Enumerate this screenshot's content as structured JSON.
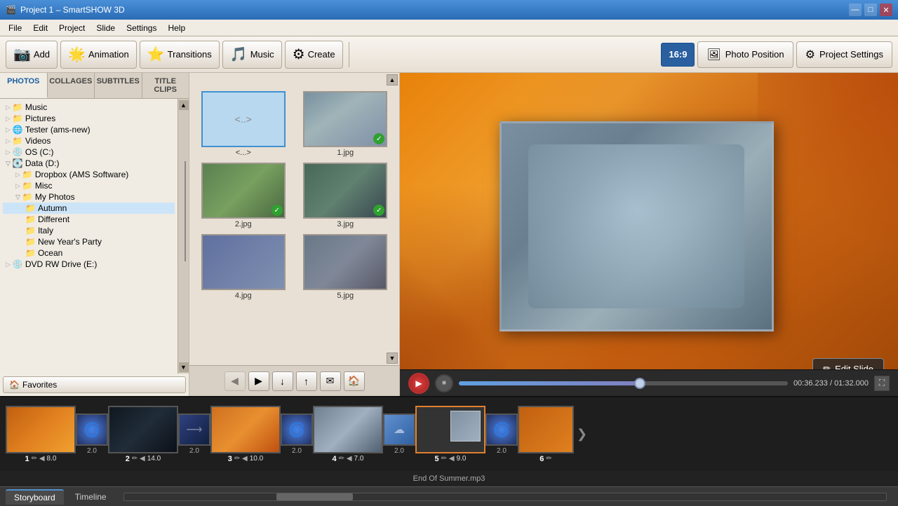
{
  "app": {
    "title": "Project 1 – SmartSHOW 3D",
    "icon": "🎬"
  },
  "titlebar": {
    "title": "Project 1 – SmartSHOW 3D",
    "minimize": "—",
    "maximize": "□",
    "close": "✕"
  },
  "menubar": {
    "items": [
      "File",
      "Edit",
      "Project",
      "Slide",
      "Settings",
      "Help"
    ]
  },
  "toolbar": {
    "add_label": "Add",
    "animation_label": "Animation",
    "transitions_label": "Transitions",
    "music_label": "Music",
    "create_label": "Create",
    "ratio_label": "16:9",
    "photo_position_label": "Photo Position",
    "project_settings_label": "Project Settings"
  },
  "left_panel": {
    "tabs": [
      "PHOTOS",
      "COLLAGES",
      "SUBTITLES",
      "TITLE CLIPS"
    ],
    "active_tab": "PHOTOS",
    "tree": [
      {
        "label": "Music",
        "icon": "folder",
        "indent": 1
      },
      {
        "label": "Pictures",
        "icon": "folder",
        "indent": 1
      },
      {
        "label": "Tester (ams-new)",
        "icon": "network",
        "indent": 1
      },
      {
        "label": "Videos",
        "icon": "folder",
        "indent": 1
      },
      {
        "label": "OS (C:)",
        "icon": "drive",
        "indent": 1
      },
      {
        "label": "Data (D:)",
        "icon": "drive",
        "indent": 0,
        "expanded": true
      },
      {
        "label": "Dropbox (AMS Software)",
        "icon": "folder",
        "indent": 2
      },
      {
        "label": "Misc",
        "icon": "folder",
        "indent": 2
      },
      {
        "label": "My Photos",
        "icon": "folder",
        "indent": 2,
        "expanded": true
      },
      {
        "label": "Autumn",
        "icon": "folder_plain",
        "indent": 3,
        "selected": true
      },
      {
        "label": "Different",
        "icon": "folder_plain",
        "indent": 3
      },
      {
        "label": "Italy",
        "icon": "folder_plain",
        "indent": 3
      },
      {
        "label": "New Year's Party",
        "icon": "folder_plain",
        "indent": 3
      },
      {
        "label": "Ocean",
        "icon": "folder_plain",
        "indent": 3
      },
      {
        "label": "DVD RW Drive (E:)",
        "icon": "drive",
        "indent": 1
      }
    ],
    "favorites_label": "Favorites"
  },
  "photo_grid": {
    "scroll_up": "▲",
    "scroll_down": "▼",
    "photos": [
      {
        "label": "<...>",
        "type": "folder",
        "selected": true
      },
      {
        "label": "1.jpg",
        "type": "family_autumn",
        "checked": true
      },
      {
        "label": "2.jpg",
        "type": "autumn_kids",
        "checked": true
      },
      {
        "label": "3.jpg",
        "type": "family_outdoor",
        "checked": true
      },
      {
        "label": "4.jpg",
        "type": "family2",
        "checked": false
      },
      {
        "label": "5.jpg",
        "type": "family3",
        "checked": false
      }
    ],
    "actions": {
      "prev": "◀",
      "next": "▶",
      "down_arrow": "↓",
      "up_arrow": "↑",
      "envelope": "✉",
      "house": "🏠"
    }
  },
  "preview": {
    "edit_slide_label": "Edit Slide"
  },
  "playback": {
    "play_icon": "▶",
    "stop_icon": "■",
    "current_time": "00:36.233",
    "total_time": "01:32.000",
    "time_separator": " / ",
    "fullscreen_icon": "⛶",
    "progress_percent": 55
  },
  "storyboard": {
    "slides": [
      {
        "num": "1",
        "type": "autumn",
        "duration": "8.0",
        "icons": "✏ ◀"
      },
      {
        "num": "2",
        "type": "dark_landscape",
        "duration": "14.0",
        "icons": "✏ ◀"
      },
      {
        "num": "3",
        "type": "autumn_kids",
        "duration": "10.0",
        "icons": "✏ ◀"
      },
      {
        "num": "4",
        "type": "family",
        "duration": "7.0",
        "icons": "✏ ◀"
      },
      {
        "num": "5",
        "type": "family_group",
        "duration": "9.0",
        "icons": "✏ ◀",
        "selected": true
      },
      {
        "num": "6",
        "type": "partial",
        "duration": "",
        "icons": "✏"
      }
    ],
    "transitions": [
      {
        "type": "swirl"
      },
      {
        "type": "slide"
      },
      {
        "type": "swirl2"
      },
      {
        "type": "cloud"
      },
      {
        "type": "swirl3"
      },
      {
        "type": "cloud2"
      }
    ],
    "transition_duration": "2.0",
    "music_label": "End Of Summer.mp3"
  },
  "bottom_tabs": {
    "storyboard_label": "Storyboard",
    "timeline_label": "Timeline",
    "active": "Storyboard"
  }
}
